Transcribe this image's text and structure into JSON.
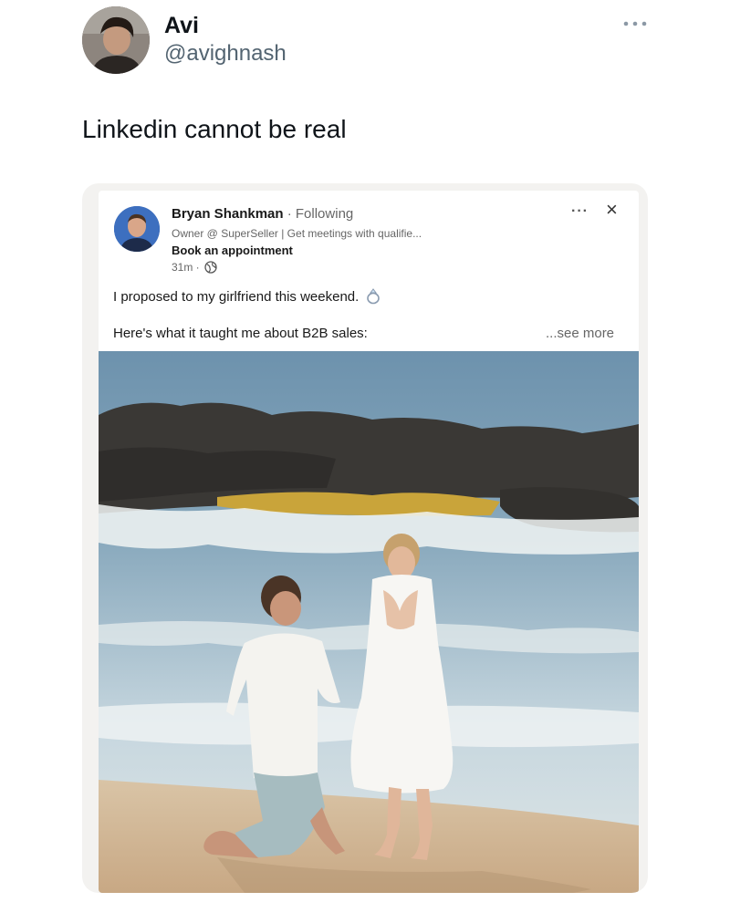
{
  "tweet": {
    "author_name": "Avi",
    "author_handle": "@avighnash",
    "text": "Linkedin cannot be real",
    "more_icon": "ellipsis-icon"
  },
  "linkedin_post": {
    "author_name": "Bryan Shankman",
    "separator": "·",
    "follow_status": "Following",
    "headline": "Owner @ SuperSeller | Get meetings with qualifie...",
    "cta": "Book an appointment",
    "time": "31m ·",
    "visibility_icon": "globe-icon",
    "menu_label": "···",
    "close_label": "×",
    "text_line1": "I proposed to my girlfriend this weekend.",
    "ring_icon": "ring-icon",
    "text_line2": "Here's what it taught me about B2B sales:",
    "see_more": "...see more"
  }
}
